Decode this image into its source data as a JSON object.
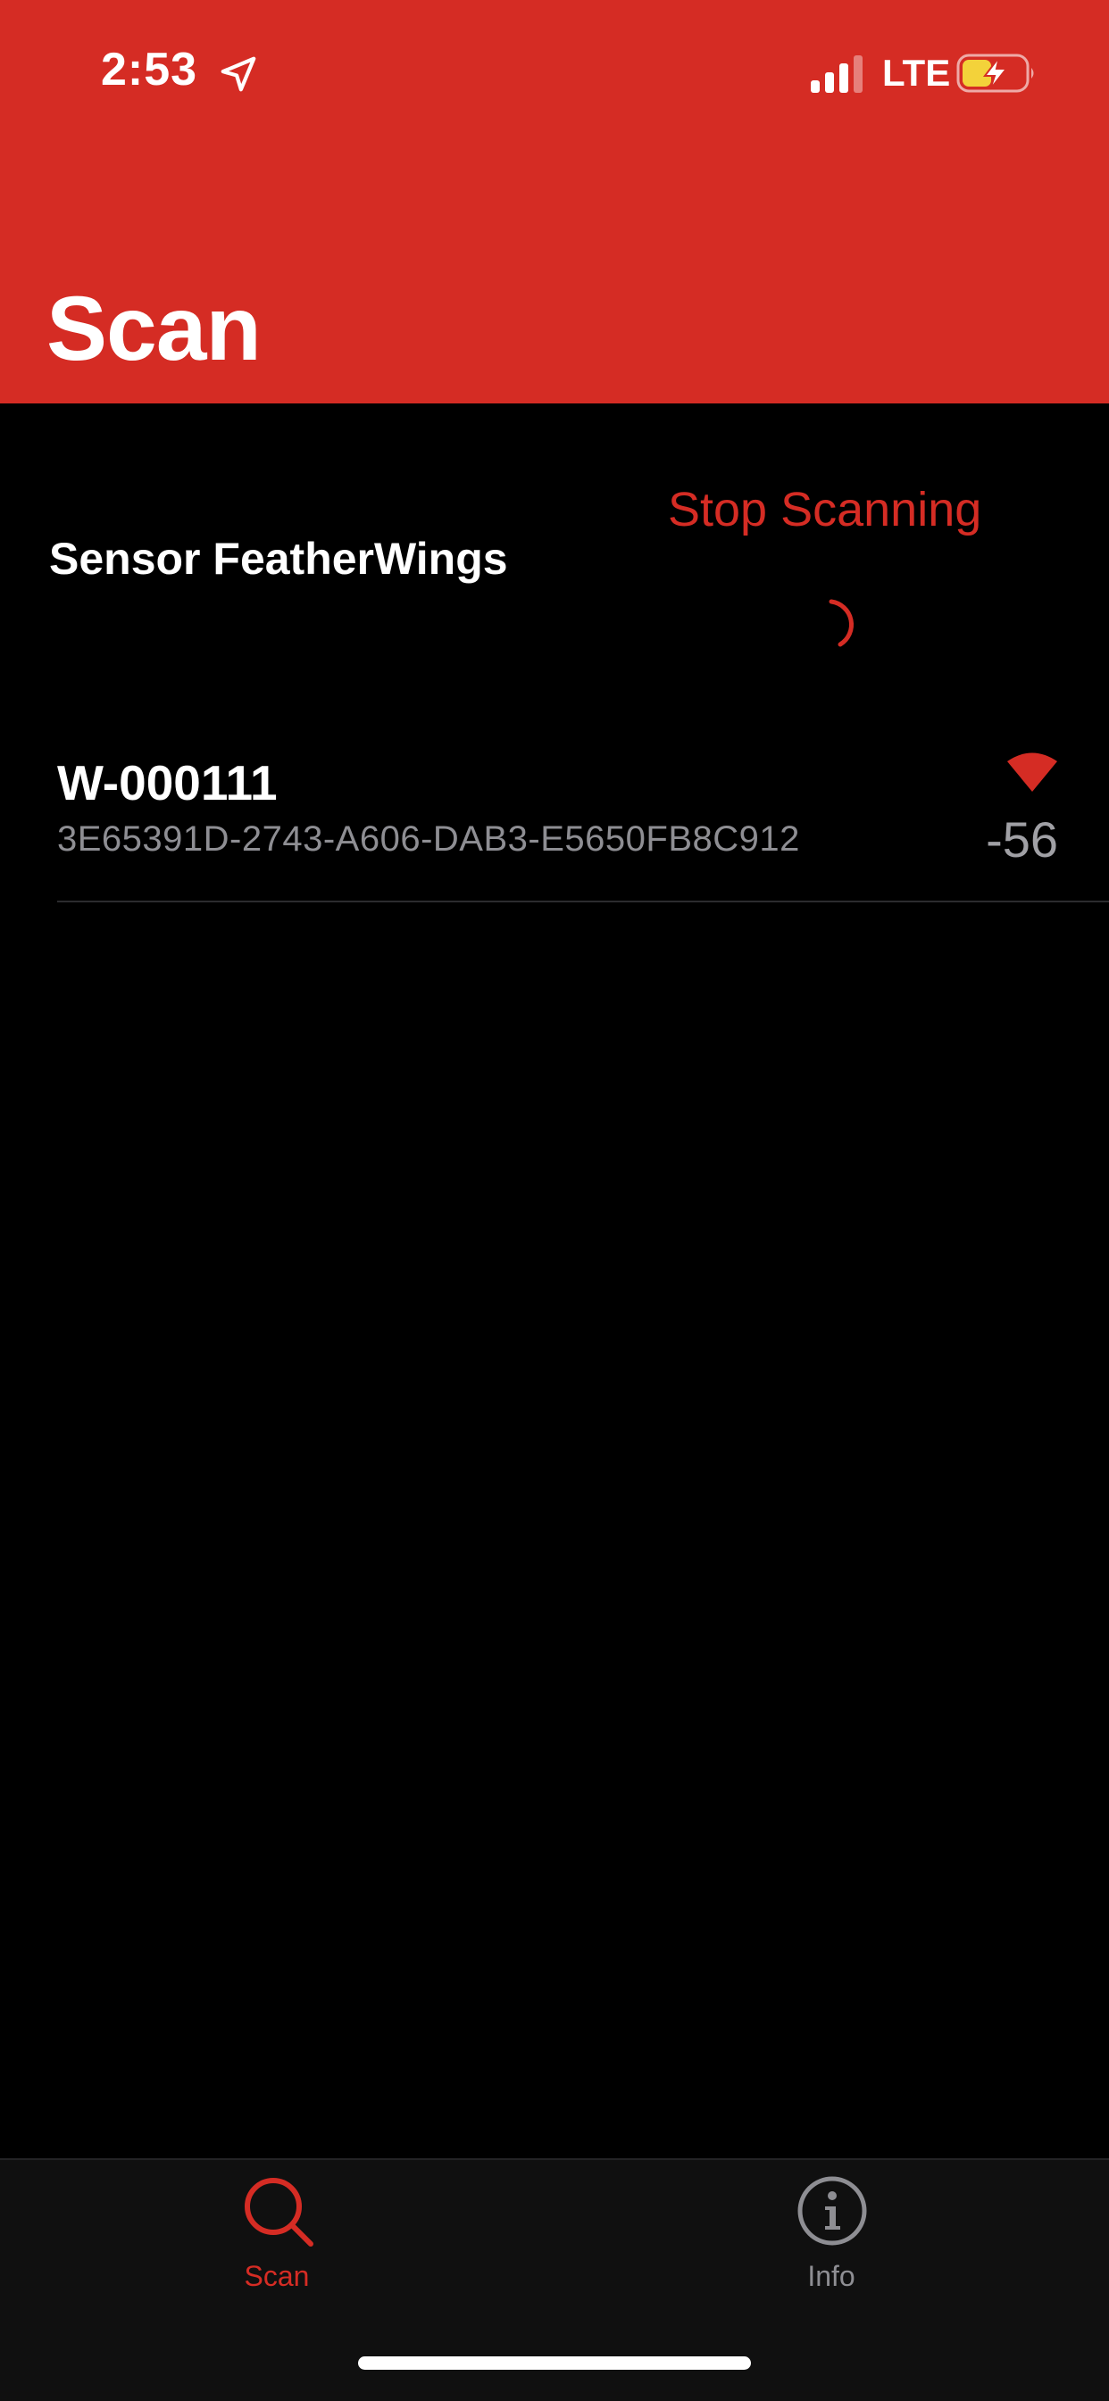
{
  "status_bar": {
    "time": "2:53",
    "network": "LTE",
    "icons": [
      "location-arrow-icon",
      "cellular-signal-icon",
      "battery-charging-icon"
    ]
  },
  "header": {
    "title": "Scan",
    "background_color": "#d52c24"
  },
  "scan": {
    "section_title": "Sensor FeatherWings",
    "stop_button_label": "Stop Scanning",
    "spinner_icon": "activity-spinner-icon",
    "devices": [
      {
        "name": "W-000111",
        "identifier": "3E65391D-2743-A606-DAB3-E5650FB8C912",
        "rssi": "-56",
        "signal_icon": "signal-strength-icon"
      }
    ]
  },
  "tab_bar": {
    "tabs": [
      {
        "label": "Scan",
        "icon": "magnifying-glass-icon",
        "selected": true
      },
      {
        "label": "Info",
        "icon": "info-circle-icon",
        "selected": false
      }
    ]
  },
  "colors": {
    "accent": "#d52c24",
    "background": "#000000",
    "secondary_text": "#8e8e93"
  }
}
